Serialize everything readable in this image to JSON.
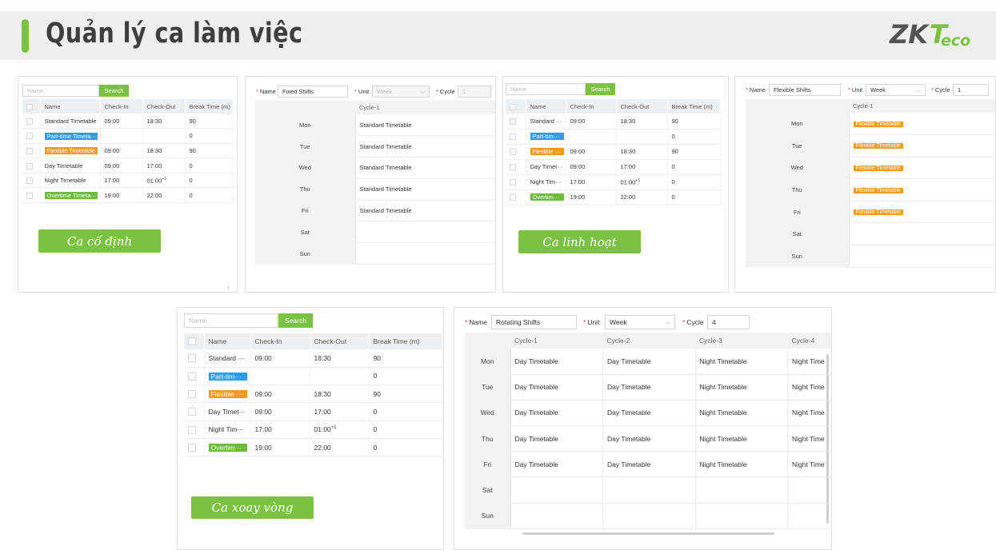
{
  "title": "Quản lý ca làm việc",
  "logo": {
    "zk": "ZK",
    "t": "T",
    "eco": "eco"
  },
  "colors": {
    "accent": "#7bc142",
    "tag_blue": "#2f9cf0",
    "tag_orange": "#f39a1f",
    "tag_green": "#6cbb3c"
  },
  "list": {
    "search_placeholder": "Name",
    "search_label": "Search",
    "headers": [
      "Name",
      "Check-In",
      "Check-Out",
      "Break Time (m)"
    ],
    "rows": [
      {
        "name": "Standard Timetable",
        "in": "09:00",
        "out": "18:30",
        "sup": "",
        "brk": "90",
        "tag": ""
      },
      {
        "name": "Part-time Timeta···",
        "in": "",
        "out": "",
        "sup": "",
        "brk": "0",
        "tag": "blue"
      },
      {
        "name": "Flexible Timetable",
        "in": "09:00",
        "out": "18:30",
        "sup": "",
        "brk": "90",
        "tag": "orange"
      },
      {
        "name": "Day Timetable",
        "in": "09:00",
        "out": "17:00",
        "sup": "",
        "brk": "0",
        "tag": ""
      },
      {
        "name": "Night Timetable",
        "in": "17:00",
        "out": "01:00",
        "sup": "+1",
        "brk": "0",
        "tag": ""
      },
      {
        "name": "Overtime Timeta···",
        "in": "19:00",
        "out": "22:00",
        "sup": "",
        "brk": "0",
        "tag": "green"
      }
    ],
    "rows_short": [
      {
        "name": "Standard ···",
        "in": "09:00",
        "out": "18:30",
        "sup": "",
        "brk": "90",
        "tag": ""
      },
      {
        "name": "Part-tim···",
        "in": "",
        "out": "",
        "sup": "",
        "brk": "0",
        "tag": "blue"
      },
      {
        "name": "Flexible ···",
        "in": "09:00",
        "out": "18:30",
        "sup": "",
        "brk": "90",
        "tag": "orange"
      },
      {
        "name": "Day Timet···",
        "in": "09:00",
        "out": "17:00",
        "sup": "",
        "brk": "0",
        "tag": ""
      },
      {
        "name": "Night Tim···",
        "in": "17:00",
        "out": "01:00",
        "sup": "+1",
        "brk": "0",
        "tag": ""
      },
      {
        "name": "Overtim···",
        "in": "19:00",
        "out": "22:00",
        "sup": "",
        "brk": "0",
        "tag": "green"
      }
    ]
  },
  "form": {
    "name_label": "Name",
    "unit_label": "Unit",
    "cycle_label": "Cycle"
  },
  "days": [
    "Mon",
    "Tue",
    "Wed",
    "Thu",
    "Fri",
    "Sat",
    "Sun"
  ],
  "fixed": {
    "banner": "Ca cố định",
    "name": "Fixed Shifts",
    "unit": "Week",
    "cycle": "1",
    "cycles": [
      "Cycle-1"
    ],
    "cells": [
      [
        "Standard Timetable"
      ],
      [
        "Standard Timetable"
      ],
      [
        "Standard Timetable"
      ],
      [
        "Standard Timetable"
      ],
      [
        "Standard Timetable"
      ],
      [
        ""
      ],
      [
        ""
      ]
    ]
  },
  "flexible": {
    "banner": "Ca linh hoạt",
    "name": "Flexible Shifts",
    "unit": "Week",
    "cycle": "1",
    "cycles": [
      "Cycle-1"
    ],
    "cells": [
      [
        "Flexible Timetable"
      ],
      [
        "Flexible Timetable"
      ],
      [
        "Flexible Timetable"
      ],
      [
        "Flexible Timetable"
      ],
      [
        "Flexible Timetable"
      ],
      [
        ""
      ],
      [
        ""
      ]
    ]
  },
  "rotating": {
    "banner": "Ca xoay vòng",
    "name": "Rotating Shifts",
    "unit": "Week",
    "cycle": "4",
    "cycles": [
      "Cycle-1",
      "Cycle-2",
      "Cycle-3",
      "Cycle-4"
    ],
    "cells": [
      [
        "Day Timetable",
        "Day Timetable",
        "Night Timetable",
        "Night Time"
      ],
      [
        "Day Timetable",
        "Day Timetable",
        "Night Timetable",
        "Night Time"
      ],
      [
        "Day Timetable",
        "Day Timetable",
        "Night Timetable",
        "Night Time"
      ],
      [
        "Day Timetable",
        "Day Timetable",
        "Night Timetable",
        "Night Time"
      ],
      [
        "Day Timetable",
        "Day Timetable",
        "Night Timetable",
        "Night Time"
      ],
      [
        "",
        "",
        "",
        ""
      ],
      [
        "",
        "",
        "",
        ""
      ]
    ]
  }
}
